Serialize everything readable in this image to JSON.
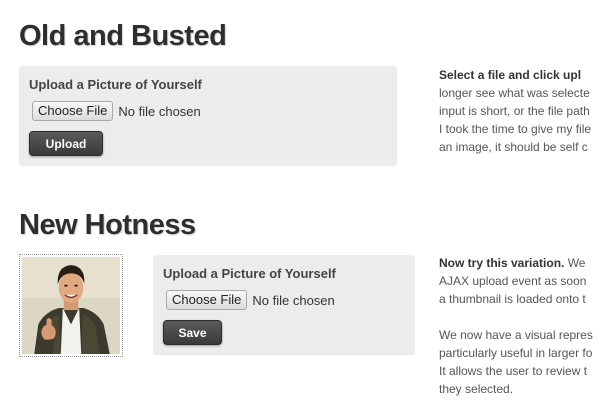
{
  "old": {
    "title": "Old and Busted",
    "upload_label": "Upload a Picture of Yourself",
    "choose_file": "Choose File",
    "no_file": "No file chosen",
    "button": "Upload",
    "description_lead": "Select a file and click upl",
    "description_lines": [
      "longer see what was selecte",
      "input is short, or the file path",
      "I took the time to give my file",
      "an image, it should be self c"
    ]
  },
  "new": {
    "title": "New Hotness",
    "upload_label": "Upload a Picture of Yourself",
    "choose_file": "Choose File",
    "no_file": "No file chosen",
    "button": "Save",
    "description_lead": "Now try this variation.",
    "description_lead_rest": " We",
    "description_lines": [
      "AJAX upload event as soon",
      "a thumbnail is loaded onto t"
    ],
    "description_lines_2": [
      "We now have a visual repres",
      "particularly useful in larger fo",
      "It allows the user to review t",
      "they selected."
    ]
  },
  "colors": {
    "box_bg": "#ececec",
    "button_dark": "#3a3a3a",
    "title": "#2e2e2e"
  }
}
